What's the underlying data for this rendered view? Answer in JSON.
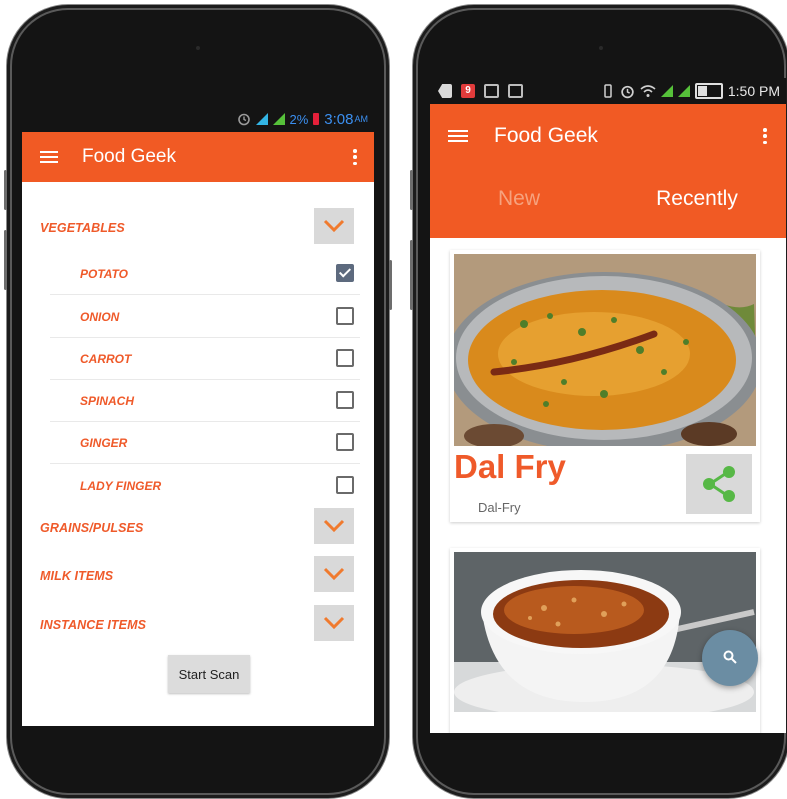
{
  "left_phone": {
    "status_bar": {
      "battery_percent": "2%",
      "time": "3:08",
      "ampm": "AM"
    },
    "app_bar": {
      "title": "Food Geek"
    },
    "categories": [
      {
        "label": "VEGETABLES",
        "expanded": true,
        "items": [
          {
            "label": "POTATO",
            "checked": true
          },
          {
            "label": "ONION",
            "checked": false
          },
          {
            "label": "CARROT",
            "checked": false
          },
          {
            "label": "SPINACH",
            "checked": false
          },
          {
            "label": "GINGER",
            "checked": false
          },
          {
            "label": "LADY FINGER",
            "checked": false
          }
        ]
      },
      {
        "label": "GRAINS/PULSES",
        "expanded": false
      },
      {
        "label": "MILK ITEMS",
        "expanded": false
      },
      {
        "label": "INSTANCE ITEMS",
        "expanded": false
      }
    ],
    "start_scan_label": "Start Scan"
  },
  "right_phone": {
    "status_bar": {
      "time": "1:50 PM",
      "notification_badge": "9"
    },
    "app_bar": {
      "title": "Food Geek"
    },
    "tabs": [
      {
        "label": "New",
        "active": false
      },
      {
        "label": "Recently",
        "active": true
      }
    ],
    "cards": [
      {
        "title": "Dal Fry",
        "subtitle": "Dal-Fry",
        "image": "dal-fry-photo"
      },
      {
        "image": "soup-bowl-photo"
      }
    ],
    "fab_icon": "search-icon"
  },
  "colors": {
    "accent": "#f15a24",
    "label": "#ef5a2a",
    "fab": "#6b8da3",
    "share": "#57b846"
  }
}
